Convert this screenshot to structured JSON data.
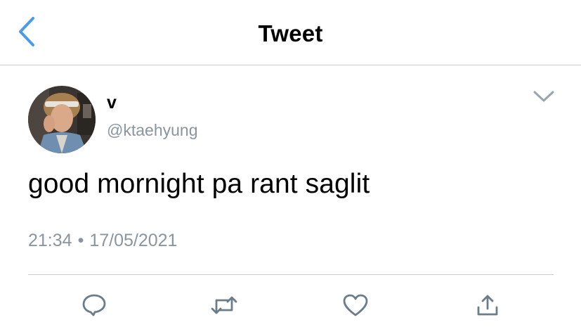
{
  "header": {
    "title": "Tweet",
    "back_icon": "chevron-left-icon",
    "accent_color": "#4a9be8"
  },
  "tweet": {
    "author": {
      "display_name": "v",
      "handle": "@ktaehyung",
      "avatar_icon": "profile-photo"
    },
    "text": "good mornight pa rant saglit",
    "time": "21:34",
    "separator": "•",
    "date": "17/05/2021",
    "menu_icon": "chevron-down-icon"
  },
  "actions": [
    {
      "name": "reply",
      "icon": "reply-icon"
    },
    {
      "name": "retweet",
      "icon": "retweet-icon"
    },
    {
      "name": "like",
      "icon": "heart-icon"
    },
    {
      "name": "share",
      "icon": "share-icon"
    }
  ],
  "colors": {
    "text": "#000000",
    "secondary": "#8a959e",
    "divider": "#c8ccd0",
    "icon": "#6b7c8a"
  }
}
